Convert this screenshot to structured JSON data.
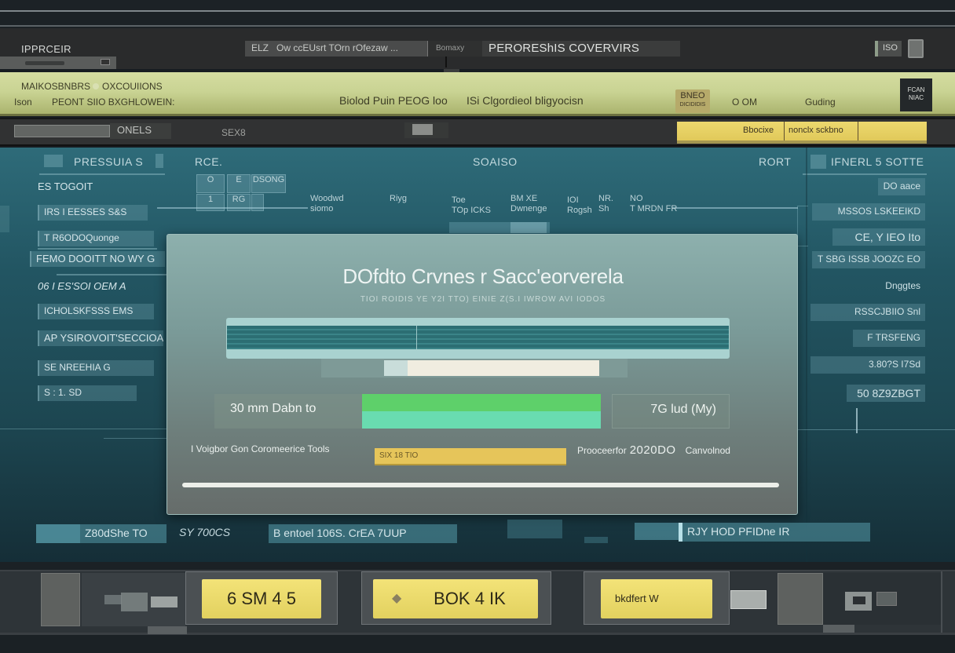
{
  "titlebar": {
    "app_label": "IPPRCEIR",
    "search_prefix": "ELZ",
    "search_value": "Ow ccEUsrt TOrn rOfezaw ...",
    "search_dropdown": "Bomaxy",
    "window_title": "PEROREShIS COVERVIRS",
    "window_button": "ISO"
  },
  "ribbon": {
    "line1_a": "MAIKOSBNBRS",
    "line1_b": "OXCOUIIONS",
    "line2_a": "Ison",
    "line2_b": "PEONT SIIO BXGHLOWEIN:",
    "center_a": "Biolod Puin PEOG loo",
    "center_b": "ISi Clgordieol bligyocisn",
    "action_button_top": "BNEO",
    "action_button_bottom": "DICIDIDIS",
    "status_a": "O OM",
    "status_b": "Guding",
    "dark_button_line1": "FCAN",
    "dark_button_line2": "NIAC"
  },
  "subbar": {
    "field_label": "ONELS",
    "number": "SEX8",
    "yellow_a": "Bbocixe",
    "yellow_b": "nonclx sckbno"
  },
  "panel": {
    "left_header": "PRESSUIA S",
    "col_header_1": "RCE.",
    "col_header_center": "SOAISO",
    "col_header_right": "RORT",
    "right_header": "IFNERL 5 SOTTE",
    "left_items": [
      {
        "label": "ES TOGOIT",
        "style": "plain"
      },
      {
        "label": "IRS I EESSES S&S",
        "style": "box"
      },
      {
        "label": "T R6ODOQuonge",
        "style": "box"
      },
      {
        "label": "FEMO DOOITT NO WY  G",
        "style": "box"
      },
      {
        "label": "06 I ES'SOI OEM A",
        "style": "plain"
      },
      {
        "label": "ICHOLSKFSSS  EMS",
        "style": "box"
      },
      {
        "label": "AP YSIROVOIT'SECCIOA",
        "style": "box"
      },
      {
        "label": "SE NREEHIA  G",
        "style": "box"
      },
      {
        "label": "S : 1.  SD",
        "style": "box"
      }
    ],
    "right_items": [
      "DO aace",
      "MSSOS LSKEEIKD",
      "CE, Y IEO Ito",
      "T SBG ISSB  JOOZC EO",
      "Dnggtes",
      "RSSCJBIIO Snl",
      "F TRSFENG",
      "3.80?S  I7Sd",
      "50  8Z9ZBGT"
    ],
    "grid_cells": [
      "O",
      "E",
      "DSONG",
      "1",
      "RG",
      ""
    ],
    "mid_labels": [
      {
        "line1": "Woodwd",
        "line2": "siomo"
      },
      {
        "line1": "Riyg",
        "line2": ""
      },
      {
        "line1": "Toe",
        "line2": "TOp ICKS"
      },
      {
        "line1": "BM  XE",
        "line2": "Dwnenge"
      },
      {
        "line1": "IOI",
        "line2": "Rogsh"
      },
      {
        "line1": "NR.",
        "line2": "Sh"
      },
      {
        "line1": "NO",
        "line2": "T MRDN FR"
      }
    ]
  },
  "dialog": {
    "title": "DOfdto Crvnes r  Sacc'eorverela",
    "subtitle": "TIOI ROIDIS YE  Y2I  TTO) EINIE Z(S.I IWROW  AVI IODOS",
    "progress_left_label": "30 mm Dabn  to",
    "progress_right_label": "7G lud (My)",
    "progress_fraction": 0.66,
    "info_left": "I  Voigbor Gon Coromeerice Tools",
    "yellow_field_value": "SIX  18  TIO",
    "info_right_prefix": "Prooceerfor",
    "info_right_value": "2020DO",
    "info_right_suffix": "Canvolnod"
  },
  "bottom_tags": {
    "left_a": "Z80dShe   TO",
    "left_b": "SY 700CS",
    "middle": "B   entoel 106S. CrEA 7UUP",
    "right": "RJY  HOD PFIDne IR"
  },
  "bottom_panel": {
    "button_1": "6 SM 4 5",
    "button_2": "BOK 4 IK",
    "button_3": "bkdfert W"
  }
}
